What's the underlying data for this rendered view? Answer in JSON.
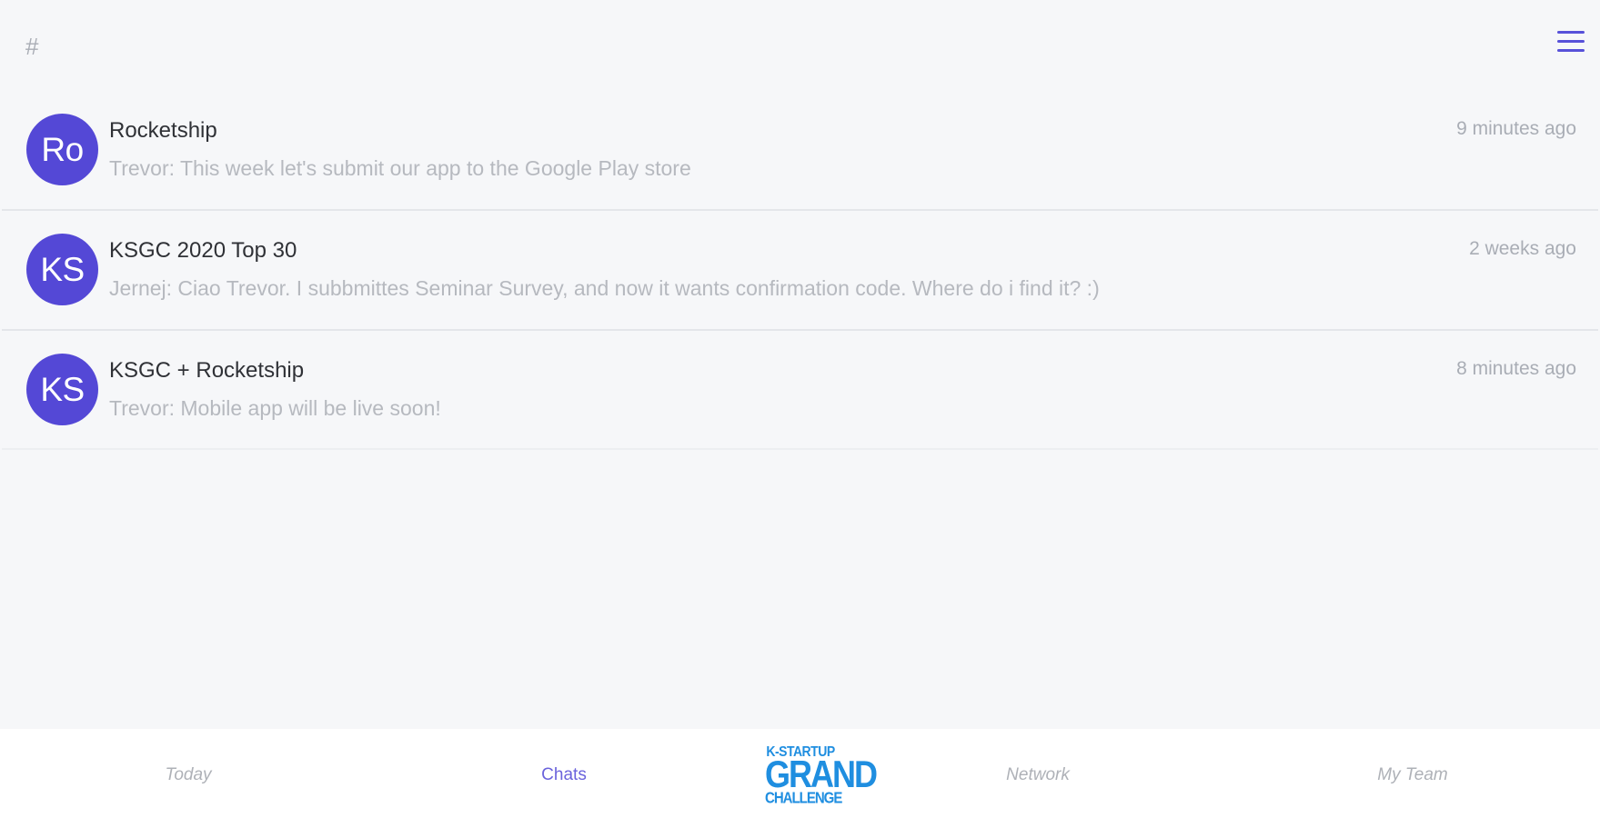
{
  "header": {
    "hash_symbol": "#",
    "menu_icon": "hamburger-menu-icon"
  },
  "chats": [
    {
      "initials": "Ro",
      "name": "Rocketship",
      "time": "9 minutes ago",
      "preview": "Trevor: This week let's submit our app to the Google Play store"
    },
    {
      "initials": "KS",
      "name": "KSGC 2020 Top 30",
      "time": "2 weeks ago",
      "preview": "Jernej: Ciao Trevor. I subbmittes Seminar Survey, and now it wants confirmation code. Where do i find it? :)"
    },
    {
      "initials": "KS",
      "name": "KSGC + Rocketship",
      "time": "8 minutes ago",
      "preview": "Trevor: Mobile app will be live soon!"
    }
  ],
  "bottom_nav": {
    "today": "Today",
    "chats": "Chats",
    "network": "Network",
    "my_team": "My Team",
    "logo": {
      "line1": "K-STARTUP",
      "line2": "GRAND",
      "line3": "CHALLENGE"
    },
    "active": "chats"
  },
  "colors": {
    "accent": "#5448d6",
    "background": "#f6f7f9",
    "logo": "#1f8ee0"
  }
}
